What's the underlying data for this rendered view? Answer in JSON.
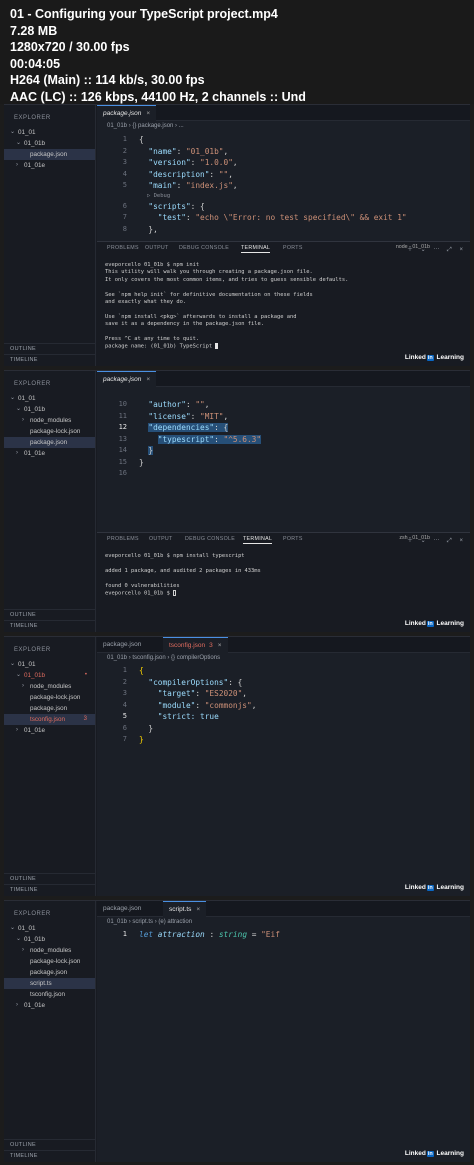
{
  "header": {
    "filename": "01 - Configuring your TypeScript project.mp4",
    "size": "7.28 MB",
    "resolution": "1280x720 / 30.00 fps",
    "duration": "00:04:05",
    "video": "H264 (Main) :: 114 kb/s, 30.00 fps",
    "audio": "AAC (LC) :: 126 kbps, 44100 Hz, 2 channels :: Und"
  },
  "watermark": {
    "pre": "Linked",
    "in": "in",
    "post": " Learning"
  },
  "frames": [
    {
      "explorer_title": "EXPLORER",
      "tree": [
        {
          "chev": "⌄",
          "label": "01_01"
        },
        {
          "chev": "⌄",
          "label": "01_01b"
        },
        {
          "chev": "",
          "label": "package.json",
          "selected": true
        },
        {
          "chev": "›",
          "label": "01_01e"
        }
      ],
      "outline": "OUTLINE",
      "timeline": "TIMELINE",
      "tabs": [
        {
          "label": "package.json",
          "close": "×"
        }
      ],
      "breadcrumb": "01_01b › {} package.json › ...",
      "code": [
        {
          "n": "1",
          "html": "<span class=\"p\">{</span>"
        },
        {
          "n": "2",
          "html": "  <span class=\"k\">\"name\"</span><span class=\"p\">: </span><span class=\"s\">\"01_01b\"</span><span class=\"p\">,</span>"
        },
        {
          "n": "3",
          "html": "  <span class=\"k\">\"version\"</span><span class=\"p\">: </span><span class=\"s\">\"1.0.0\"</span><span class=\"p\">,</span>"
        },
        {
          "n": "4",
          "html": "  <span class=\"k\">\"description\"</span><span class=\"p\">: </span><span class=\"s\">\"\"</span><span class=\"p\">,</span>"
        },
        {
          "n": "5",
          "html": "  <span class=\"k\">\"main\"</span><span class=\"p\">: </span><span class=\"s\">\"index.js\"</span><span class=\"p\">,</span>"
        },
        {
          "lens": "▷ Debug"
        },
        {
          "n": "6",
          "html": "  <span class=\"k\">\"scripts\"</span><span class=\"p\">: {</span>"
        },
        {
          "n": "7",
          "html": "    <span class=\"k\">\"test\"</span><span class=\"p\">: </span><span class=\"s\">\"echo \\\"Error: no test specified\\\" &amp;&amp; exit 1\"</span>"
        },
        {
          "n": "8",
          "html": "  <span class=\"p\">},</span>"
        }
      ],
      "panel_tabs": [
        "PROBLEMS",
        "OUTPUT",
        "DEBUG CONSOLE",
        "TERMINAL",
        "PORTS"
      ],
      "terminal_selector": "node - 01_01b",
      "terminal": [
        "eveporcello 01_01b $ npm init",
        "This utility will walk you through creating a package.json file.",
        "It only covers the most common items, and tries to guess sensible defaults.",
        "",
        "See `npm help init` for definitive documentation on these fields",
        "and exactly what they do.",
        "",
        "Use `npm install <pkg>` afterwards to install a package and",
        "save it as a dependency in the package.json file.",
        "",
        "Press ^C at any time to quit.",
        "package name: (01_01b) TypeScript"
      ]
    },
    {
      "explorer_title": "EXPLORER",
      "tree": [
        {
          "chev": "⌄",
          "label": "01_01"
        },
        {
          "chev": "⌄",
          "label": "01_01b"
        },
        {
          "chev": "›",
          "label": "node_modules"
        },
        {
          "chev": "",
          "label": "package-lock.json"
        },
        {
          "chev": "",
          "label": "package.json",
          "selected": true
        },
        {
          "chev": "›",
          "label": "01_01e"
        }
      ],
      "outline": "OUTLINE",
      "timeline": "TIMELINE",
      "tabs": [
        {
          "label": "package.json",
          "close": "×"
        }
      ],
      "code": [
        {
          "n": "10",
          "html": "  <span class=\"k\">\"author\"</span><span class=\"p\">: </span><span class=\"s\">\"\"</span><span class=\"p\">,</span>"
        },
        {
          "n": "11",
          "html": "  <span class=\"k\">\"license\"</span><span class=\"p\">: </span><span class=\"s\">\"MIT\"</span><span class=\"p\">,</span>"
        },
        {
          "n": "12",
          "html": "  <span class=\"hl\"><span class=\"k\">\"dependencies\"</span><span class=\"p\">: {</span></span>",
          "cur": true
        },
        {
          "n": "13",
          "html": "    <span class=\"hl\"><span class=\"k\">\"typescript\"</span><span class=\"p\">: </span><span class=\"s\">\"^5.6.3\"</span></span>"
        },
        {
          "n": "14",
          "html": "  <span class=\"hl\"><span class=\"p\">}</span></span>"
        },
        {
          "n": "15",
          "html": "<span class=\"p\">}</span>"
        },
        {
          "n": "16",
          "html": ""
        }
      ],
      "panel_tabs": [
        "PROBLEMS",
        "OUTPUT",
        "DEBUG CONSOLE",
        "TERMINAL",
        "PORTS"
      ],
      "terminal_selector": "zsh - 01_01b",
      "terminal": [
        "eveporcello 01_01b $ npm install typescript",
        "",
        "added 1 package, and audited 2 packages in 433ms",
        "",
        "found 0 vulnerabilities",
        "eveporcello 01_01b $"
      ]
    },
    {
      "explorer_title": "EXPLORER",
      "tree": [
        {
          "chev": "⌄",
          "label": "01_01"
        },
        {
          "chev": "⌄",
          "label": "01_01b",
          "red": true,
          "badge": "•"
        },
        {
          "chev": "›",
          "label": "node_modules"
        },
        {
          "chev": "",
          "label": "package-lock.json"
        },
        {
          "chev": "",
          "label": "package.json"
        },
        {
          "chev": "",
          "label": "tsconfig.json",
          "selected": true,
          "red": true,
          "badge": "3"
        },
        {
          "chev": "›",
          "label": "01_01e"
        }
      ],
      "outline": "OUTLINE",
      "timeline": "TIMELINE",
      "tabs": [
        {
          "label": "package.json",
          "close": ""
        },
        {
          "label": "tsconfig.json",
          "close": "×",
          "suffix": "3",
          "red": true
        }
      ],
      "breadcrumb": "01_01b › tsconfig.json › {} compilerOptions",
      "code": [
        {
          "n": "1",
          "html": "<span class=\"b\">{</span>"
        },
        {
          "n": "2",
          "html": "  <span class=\"k\">\"compilerOptions\"</span><span class=\"p\">: {</span>"
        },
        {
          "n": "3",
          "html": "    <span class=\"k\">\"target\"</span><span class=\"p\">: </span><span class=\"s\">\"ES2020\"</span><span class=\"p\">,</span>"
        },
        {
          "n": "4",
          "html": "    <span class=\"k\">\"module\"</span><span class=\"p\">: </span><span class=\"s\">\"commonjs\"</span><span class=\"p\">,</span>"
        },
        {
          "n": "5",
          "html": "    <span class=\"k\">\"strict: true</span>",
          "cur": true
        },
        {
          "n": "6",
          "html": "  <span class=\"p\">}</span>"
        },
        {
          "n": "7",
          "html": "<span class=\"b\">}</span>"
        }
      ]
    },
    {
      "explorer_title": "EXPLORER",
      "tree": [
        {
          "chev": "⌄",
          "label": "01_01"
        },
        {
          "chev": "⌄",
          "label": "01_01b"
        },
        {
          "chev": "›",
          "label": "node_modules"
        },
        {
          "chev": "",
          "label": "package-lock.json"
        },
        {
          "chev": "",
          "label": "package.json"
        },
        {
          "chev": "",
          "label": "script.ts",
          "selected": true
        },
        {
          "chev": "",
          "label": "tsconfig.json"
        },
        {
          "chev": "›",
          "label": "01_01e"
        }
      ],
      "outline": "OUTLINE",
      "timeline": "TIMELINE",
      "tabs": [
        {
          "label": "package.json",
          "close": ""
        },
        {
          "label": "script.ts",
          "close": "×"
        }
      ],
      "breadcrumb": "01_01b › script.ts › (e) attraction",
      "code": [
        {
          "n": "1",
          "html": "<span class=\"kw\">let</span> <span class=\"v\">attraction</span> <span class=\"p\">: </span><span class=\"ty\">string</span> <span class=\"p\">= </span><span class=\"s\">\"Eif</span>",
          "cur": true
        }
      ]
    }
  ]
}
